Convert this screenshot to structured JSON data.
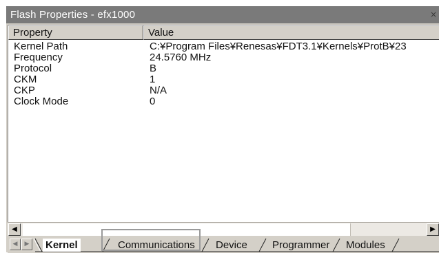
{
  "window": {
    "title": "Flash Properties - efx1000",
    "close_glyph": "×"
  },
  "columns": {
    "property": "Property",
    "value": "Value"
  },
  "rows": [
    {
      "property": "Kernel Path",
      "value": "C:¥Program Files¥Renesas¥FDT3.1¥Kernels¥ProtB¥23"
    },
    {
      "property": "Frequency",
      "value": "24.5760 MHz"
    },
    {
      "property": "Protocol",
      "value": "B"
    },
    {
      "property": "CKM",
      "value": "1"
    },
    {
      "property": "CKP",
      "value": "N/A"
    },
    {
      "property": "Clock Mode",
      "value": "0"
    }
  ],
  "scrollbar": {
    "left_arrow": "◀",
    "right_arrow": "▶"
  },
  "tabs": {
    "nav_first": "◀",
    "nav_last": "▶",
    "items": [
      {
        "label": "Kernel",
        "active": true
      },
      {
        "label": "Communications",
        "active": false
      },
      {
        "label": "Device",
        "active": false
      },
      {
        "label": "Programmer",
        "active": false
      },
      {
        "label": "Modules",
        "active": false
      }
    ]
  }
}
